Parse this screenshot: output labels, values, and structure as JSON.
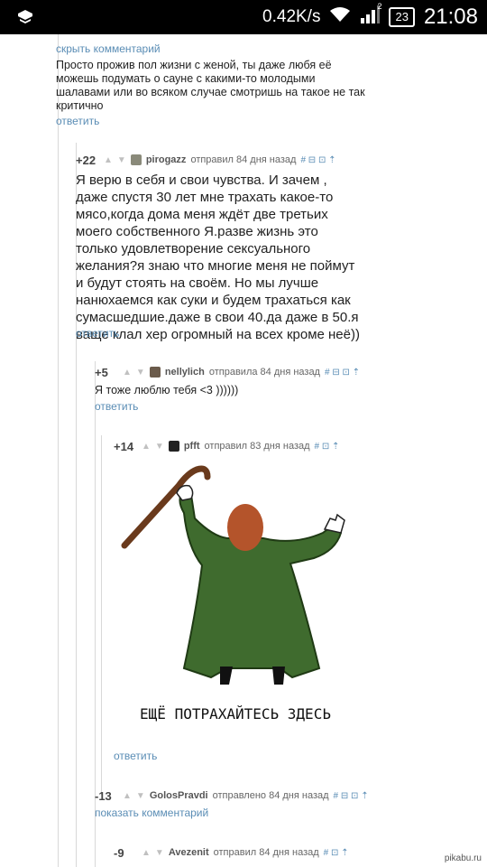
{
  "status_bar": {
    "speed": "0.42K/s",
    "signal_badge": "2",
    "battery": "23",
    "time": "21:08"
  },
  "comments": [
    {
      "hide_label": "скрыть комментарий",
      "text": "Просто прожив пол жизни с женой, ты даже любя её можешь подумать о сауне с какими-то молодыми шалавами или во всяком случае смотришь на такое не так критично",
      "reply": "ответить"
    },
    {
      "score": "+22",
      "user": "pirogazz",
      "posted": "отправил 84 дня назад",
      "icons": "# ⊟ ⊡ ⇡",
      "text": "Я верю в себя и свои чувства. И зачем , даже спустя 30 лет мне трахать какое-то мясо,когда дома меня ждёт две третьих моего собственного Я.разве жизнь это только удовлетворение сексуального желания?я знаю что многие меня не поймут и будут стоять на своём. Но мы лучше нанюхаемся как суки и будем трахаться как сумасшедшие.даже в свои 40.да даже в 50.я ваще клал хер огромный на всех кроме неё))",
      "reply": "ответить"
    },
    {
      "score": "+5",
      "user": "nellylich",
      "posted": "отправила 84 дня назад",
      "icons": "# ⊟ ⊡ ⇡",
      "text": "Я тоже люблю тебя <3 ))))))",
      "reply": "ответить"
    },
    {
      "score": "+14",
      "user": "pfft",
      "posted": "отправил 83 дня назад",
      "icons": "# ⊡ ⇡",
      "meme_caption": "ЕЩЁ ПОТРАХАЙТЕСЬ ЗДЕСЬ",
      "reply": "ответить"
    },
    {
      "score": "-13",
      "user": "GolosPravdi",
      "posted": "отправлено 84 дня назад",
      "icons": "# ⊟ ⊡ ⇡",
      "show_label": "показать комментарий"
    },
    {
      "score": "-9",
      "user": "Avezenit",
      "posted": "отправил 84 дня назад",
      "icons": "# ⊡ ⇡"
    }
  ],
  "watermark": "pikabu.ru",
  "colors": {
    "link": "#5a8db5",
    "coat": "#3f6b2e",
    "hair": "#b4542b",
    "cane": "#6a3a1c"
  }
}
